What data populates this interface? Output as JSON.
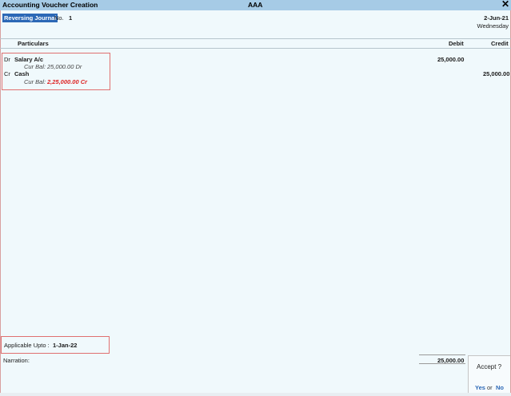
{
  "titlebar": {
    "title": "Accounting Voucher Creation",
    "company": "AAA",
    "close_icon": "close-icon"
  },
  "voucher": {
    "type": "Reversing Journal",
    "no_label": "No.",
    "no_value": "1",
    "date": "2-Jun-21",
    "day": "Wednesday"
  },
  "columns": {
    "particulars": "Particulars",
    "debit": "Debit",
    "credit": "Credit"
  },
  "entries": [
    {
      "drcr": "Dr",
      "ledger": "Salary A/c",
      "curbal_label": "Cur Bal:",
      "curbal_value": "25,000.00 Dr",
      "debit": "25,000.00",
      "credit": ""
    },
    {
      "drcr": "Cr",
      "ledger": "Cash",
      "curbal_label": "Cur Bal:",
      "curbal_value": "2,25,000.00 Cr",
      "debit": "",
      "credit": "25,000.00"
    }
  ],
  "applicable": {
    "label": "Applicable Upto :",
    "value": "1-Jan-22"
  },
  "narration": {
    "label": "Narration:"
  },
  "total": {
    "debit": "25,000.00"
  },
  "accept": {
    "title": "Accept ?",
    "yes": "Yes",
    "or": "or",
    "no": "No"
  },
  "colors": {
    "titlebar": "#a6cbe6",
    "background": "#f0f9fc",
    "voucher_type_bg": "#2c68b6",
    "highlight_box": "#e07070",
    "negative_balance": "#dd2222"
  }
}
